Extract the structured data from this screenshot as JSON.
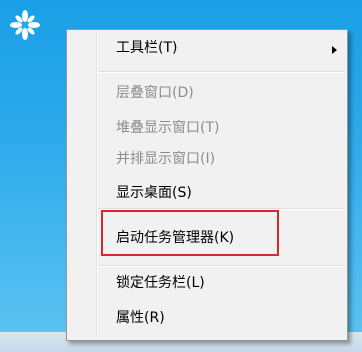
{
  "desktop": {
    "background_color": "#2aa8ea",
    "icon": "flower-logo-icon"
  },
  "context_menu": {
    "items": [
      {
        "label": "工具栏(T)",
        "enabled": true,
        "has_submenu": true
      },
      {
        "label": "层叠窗口(D)",
        "enabled": false
      },
      {
        "label": "堆叠显示窗口(T)",
        "enabled": false
      },
      {
        "label": "并排显示窗口(I)",
        "enabled": false
      },
      {
        "label": "显示桌面(S)",
        "enabled": true
      },
      {
        "label": "启动任务管理器(K)",
        "enabled": true,
        "highlighted": true
      },
      {
        "label": "锁定任务栏(L)",
        "enabled": true
      },
      {
        "label": "属性(R)",
        "enabled": true
      }
    ],
    "highlight_color": "#d9272e"
  }
}
